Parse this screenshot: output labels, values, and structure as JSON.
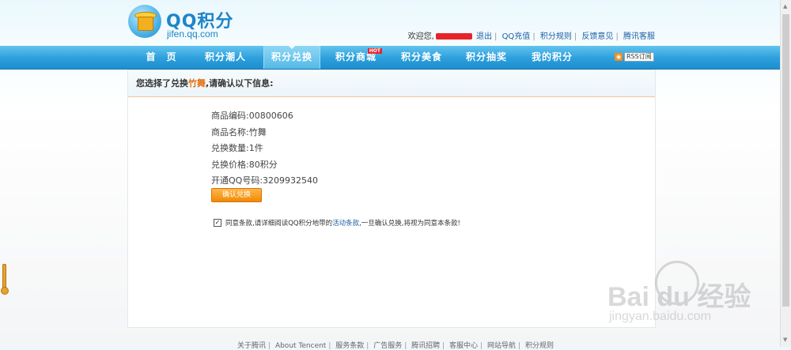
{
  "header": {
    "logo_title_latin": "QQ",
    "logo_title_cn": "积分",
    "logo_url": "jifen.qq.com",
    "welcome": "欢迎您,",
    "links": [
      "退出",
      "QQ充值",
      "积分规则",
      "反馈意见",
      "腾讯客服"
    ]
  },
  "nav": {
    "items": [
      "首　页",
      "积分潮人",
      "积分兑换",
      "积分商城",
      "积分美食",
      "积分抽奖",
      "我的积分"
    ],
    "active_index": 2,
    "hot_badge": "HOT",
    "rss_label": "RSS订阅"
  },
  "panel": {
    "title_prefix": "您选择了兑换",
    "title_item": "竹舞",
    "title_suffix": ",请确认以下信息:",
    "rows": [
      "商品编码:00800606",
      "商品名称:竹舞",
      "兑换数量:1件",
      "兑换价格:80积分",
      "开通QQ号码:3209932540"
    ],
    "confirm_button": "确认兑换",
    "agree_prefix": "同意条款,请详细阅读QQ积分地带的",
    "agree_link": "活动条款",
    "agree_suffix": ",一旦确认兑换,将视为同意本条款!",
    "agree_checked": true
  },
  "footer": {
    "links": [
      "关于腾讯",
      "About Tencent",
      "服务条款",
      "广告服务",
      "腾讯招聘",
      "客服中心",
      "网站导航",
      "积分规则"
    ]
  },
  "watermark": {
    "brand": "Bai du 经验",
    "url": "jingyan.baidu.com"
  },
  "colors": {
    "nav_blue": "#2c9fdc",
    "link_blue": "#1d5fa6",
    "highlight_orange": "#e36c09",
    "button_orange": "#f08a06"
  }
}
